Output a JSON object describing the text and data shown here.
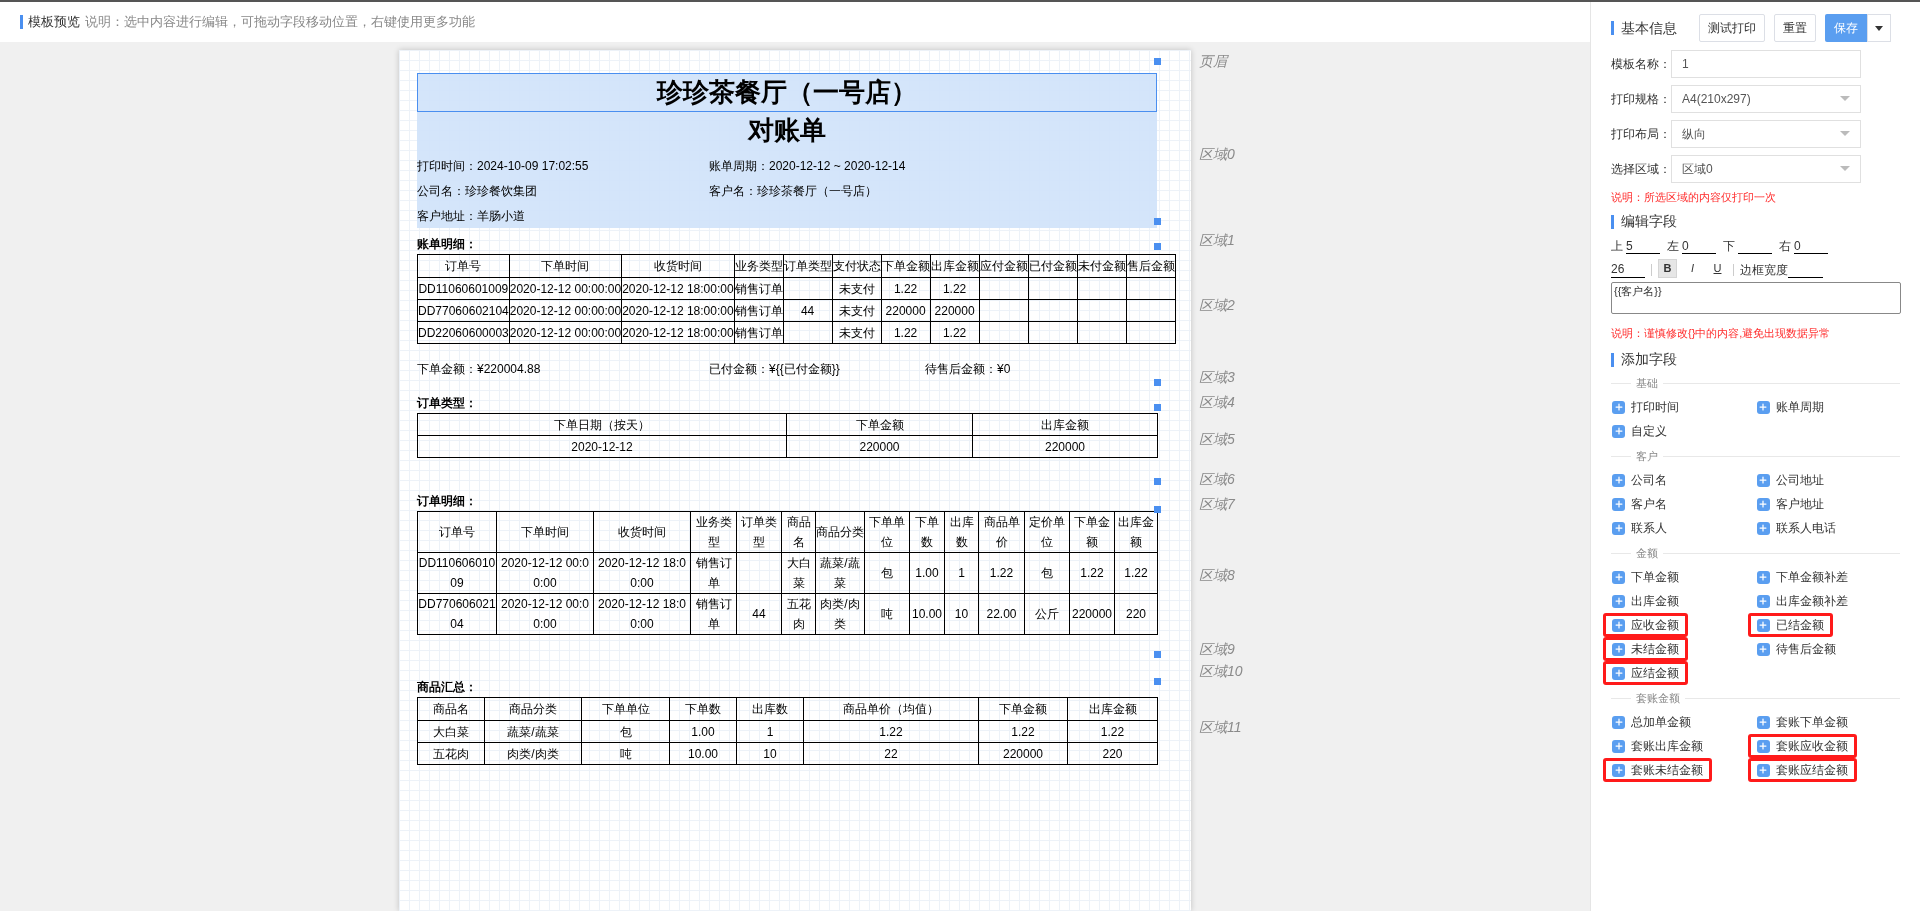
{
  "top_bar": {
    "title": "模板预览",
    "hint": "说明：选中内容进行编辑，可拖动字段移动位置，右键使用更多功能"
  },
  "document": {
    "region_labels": [
      "页眉",
      "区域0",
      "区域1",
      "区域2",
      "区域3",
      "区域4",
      "区域5",
      "区域6",
      "区域7",
      "区域8",
      "区域9",
      "区域10",
      "区域11"
    ],
    "title": "珍珍茶餐厅（一号店）",
    "subtitle": "对账单",
    "info_rows": [
      [
        "打印时间：2024-10-09 17:02:55",
        "账单周期：2020-12-12 ~ 2020-12-14"
      ],
      [
        "公司名：珍珍餐饮集团",
        "客户名：珍珍茶餐厅（一号店）"
      ],
      [
        "客户地址：羊肠小道"
      ]
    ],
    "bill_detail": {
      "label": "账单明细：",
      "columns": [
        "订单号",
        "下单时间",
        "收货时间",
        "业务类型",
        "订单类型",
        "支付状态",
        "下单金额",
        "出库金额",
        "应付金额",
        "已付金额",
        "未付金额",
        "售后金额"
      ],
      "rows": [
        [
          "DD11060601009",
          "2020-12-12 00:00:00",
          "2020-12-12 18:00:00",
          "销售订单",
          "",
          "未支付",
          "1.22",
          "1.22",
          "",
          "",
          "",
          ""
        ],
        [
          "DD77060602104",
          "2020-12-12 00:00:00",
          "2020-12-12 18:00:00",
          "销售订单",
          "44",
          "未支付",
          "220000",
          "220000",
          "",
          "",
          "",
          ""
        ],
        [
          "DD22060600003",
          "2020-12-12 00:00:00",
          "2020-12-12 18:00:00",
          "销售订单",
          "",
          "未支付",
          "1.22",
          "1.22",
          "",
          "",
          "",
          ""
        ]
      ]
    },
    "summary": [
      "下单金额：¥220004.88",
      "已付金额：¥{{已付金额}}",
      "待售后金额：¥0"
    ],
    "order_type": {
      "label": "订单类型：",
      "columns": [
        "下单日期（按天）",
        "下单金额",
        "出库金额"
      ],
      "rows": [
        [
          "2020-12-12",
          "220000",
          "220000"
        ]
      ]
    },
    "order_detail": {
      "label": "订单明细：",
      "columns": [
        "订单号",
        "下单时间",
        "收货时间",
        "业务类型",
        "订单类型",
        "商品名",
        "商品分类",
        "下单单位",
        "下单数",
        "出库数",
        "商品单价",
        "定价单位",
        "下单金额",
        "出库金额"
      ],
      "rows": [
        [
          "DD11060601009",
          "2020-12-12 00:00:00",
          "2020-12-12 18:00:00",
          "销售订单",
          "",
          "大白菜",
          "蔬菜/蔬菜",
          "包",
          "1.00",
          "1",
          "1.22",
          "包",
          "1.22",
          "1.22"
        ],
        [
          "DD77060602104",
          "2020-12-12 00:00:00",
          "2020-12-12 18:00:00",
          "销售订单",
          "44",
          "五花肉",
          "肉类/肉类",
          "吨",
          "10.00",
          "10",
          "22.00",
          "公斤",
          "220000",
          "220"
        ]
      ]
    },
    "goods_summary": {
      "label": "商品汇总：",
      "columns": [
        "商品名",
        "商品分类",
        "下单单位",
        "下单数",
        "出库数",
        "商品单价（均值）",
        "下单金额",
        "出库金额"
      ],
      "rows": [
        [
          "大白菜",
          "蔬菜/蔬菜",
          "包",
          "1.00",
          "1",
          "1.22",
          "1.22",
          "1.22"
        ],
        [
          "五花肉",
          "肉类/肉类",
          "吨",
          "10.00",
          "10",
          "22",
          "220000",
          "220"
        ]
      ]
    }
  },
  "panel": {
    "basic_title": "基本信息",
    "buttons": [
      {
        "label": "测试打印",
        "kind": "default"
      },
      {
        "label": "重置",
        "kind": "default"
      },
      {
        "label": "保存",
        "kind": "primary"
      },
      {
        "kind": "caret"
      }
    ],
    "form": [
      {
        "label": "模板名称：",
        "value": "1",
        "kind": "text"
      },
      {
        "label": "打印规格：",
        "value": "A4(210x297)",
        "kind": "select"
      },
      {
        "label": "打印布局：",
        "value": "纵向",
        "kind": "select"
      },
      {
        "label": "选择区域：",
        "value": "区域0",
        "kind": "select"
      }
    ],
    "region_note": "说明：所选区域的内容仅打印一次",
    "edit_title": "编辑字段",
    "margins": [
      {
        "label": "上",
        "value": "5"
      },
      {
        "label": "左",
        "value": "0"
      },
      {
        "label": "下"
      },
      {
        "label": "右",
        "value": "0"
      }
    ],
    "font_size": "26",
    "style_buttons": [
      {
        "label": "B",
        "kind": "bold",
        "selected": true
      },
      {
        "label": "I",
        "kind": "italic",
        "selected": false
      },
      {
        "label": "U",
        "kind": "underline",
        "selected": false
      }
    ],
    "border_label": "边框宽度",
    "content": "{{客户名}}",
    "content_note": "说明：谨慎修改{}中的内容,避免出现数据异常",
    "add_title": "添加字段",
    "groups": [
      {
        "title": "基础",
        "items": [
          {
            "label": "打印时间",
            "highlighted": false
          },
          {
            "label": "账单周期",
            "highlighted": false
          },
          {
            "label": "自定义",
            "highlighted": false
          }
        ]
      },
      {
        "title": "客户",
        "items": [
          {
            "label": "公司名",
            "highlighted": false
          },
          {
            "label": "公司地址",
            "highlighted": false
          },
          {
            "label": "客户名",
            "highlighted": false
          },
          {
            "label": "客户地址",
            "highlighted": false
          },
          {
            "label": "联系人",
            "highlighted": false
          },
          {
            "label": "联系人电话",
            "highlighted": false
          }
        ]
      },
      {
        "title": "金额",
        "items": [
          {
            "label": "下单金额",
            "highlighted": false
          },
          {
            "label": "下单金额补差",
            "highlighted": false
          },
          {
            "label": "出库金额",
            "highlighted": false
          },
          {
            "label": "出库金额补差",
            "highlighted": false
          },
          {
            "label": "应收金额",
            "highlighted": true
          },
          {
            "label": "已结金额",
            "highlighted": true
          },
          {
            "label": "未结金额",
            "highlighted": true
          },
          {
            "label": "待售后金额",
            "highlighted": false
          },
          {
            "label": "应结金额",
            "highlighted": true
          }
        ]
      },
      {
        "title": "套账金额",
        "items": [
          {
            "label": "总加单金额",
            "highlighted": false
          },
          {
            "label": "套账下单金额",
            "highlighted": false
          },
          {
            "label": "套账出库金额",
            "highlighted": false
          },
          {
            "label": "套账应收金额",
            "highlighted": true
          },
          {
            "label": "套账未结金额",
            "highlighted": true
          },
          {
            "label": "套账应结金额",
            "highlighted": true
          }
        ]
      }
    ]
  }
}
